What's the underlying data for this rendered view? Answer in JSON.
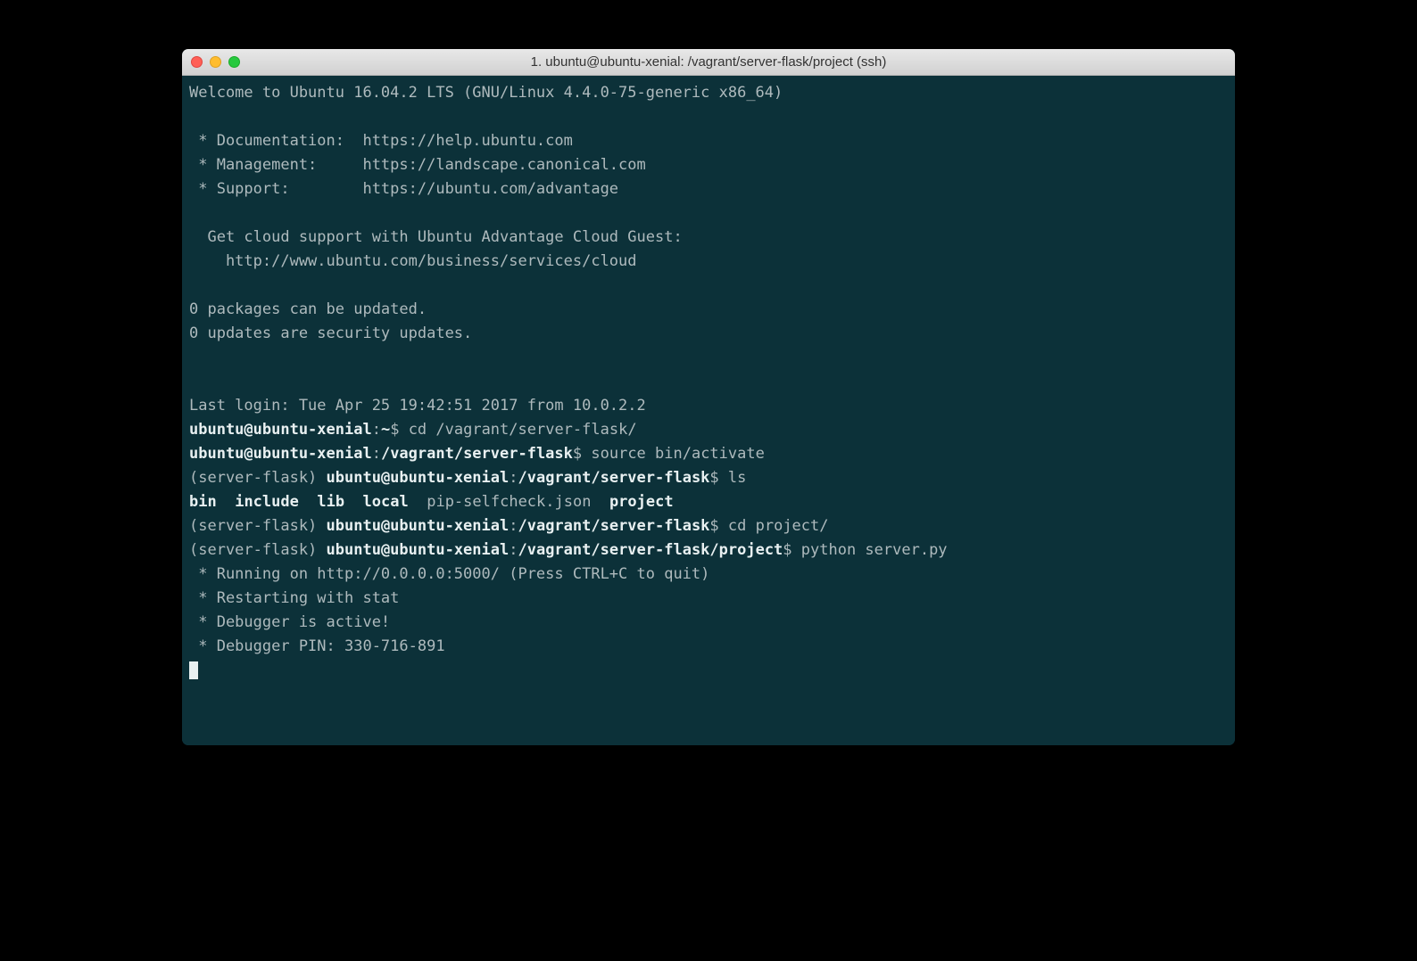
{
  "window": {
    "title": "1. ubuntu@ubuntu-xenial: /vagrant/server-flask/project (ssh)"
  },
  "motd": {
    "welcome": "Welcome to Ubuntu 16.04.2 LTS (GNU/Linux 4.4.0-75-generic x86_64)",
    "doc_label": " * Documentation:  https://help.ubuntu.com",
    "mgmt_label": " * Management:     https://landscape.canonical.com",
    "support_label": " * Support:        https://ubuntu.com/advantage",
    "cloud1": "  Get cloud support with Ubuntu Advantage Cloud Guest:",
    "cloud2": "    http://www.ubuntu.com/business/services/cloud",
    "pkg1": "0 packages can be updated.",
    "pkg2": "0 updates are security updates."
  },
  "lastlogin": "Last login: Tue Apr 25 19:42:51 2017 from 10.0.2.2",
  "prompts": {
    "p1_user": "ubuntu@ubuntu-xenial",
    "p1_sep": ":",
    "p1_path": "~",
    "p1_dollar": "$ ",
    "p1_cmd": "cd /vagrant/server-flask/",
    "p2_user": "ubuntu@ubuntu-xenial",
    "p2_sep": ":",
    "p2_path": "/vagrant/server-flask",
    "p2_dollar": "$ ",
    "p2_cmd": "source bin/activate",
    "venv": "(server-flask) ",
    "p3_user": "ubuntu@ubuntu-xenial",
    "p3_path": "/vagrant/server-flask",
    "p3_cmd": "ls",
    "ls_bin": "bin",
    "ls_include": "include",
    "ls_lib": "lib",
    "ls_local": "local",
    "ls_pip": "pip-selfcheck.json",
    "ls_project": "project",
    "p4_user": "ubuntu@ubuntu-xenial",
    "p4_path": "/vagrant/server-flask",
    "p4_cmd": "cd project/",
    "p5_user": "ubuntu@ubuntu-xenial",
    "p5_path": "/vagrant/server-flask/project",
    "p5_cmd": "python server.py"
  },
  "output": {
    "o1": " * Running on http://0.0.0.0:5000/ (Press CTRL+C to quit)",
    "o2": " * Restarting with stat",
    "o3": " * Debugger is active!",
    "o4": " * Debugger PIN: 330-716-891"
  }
}
